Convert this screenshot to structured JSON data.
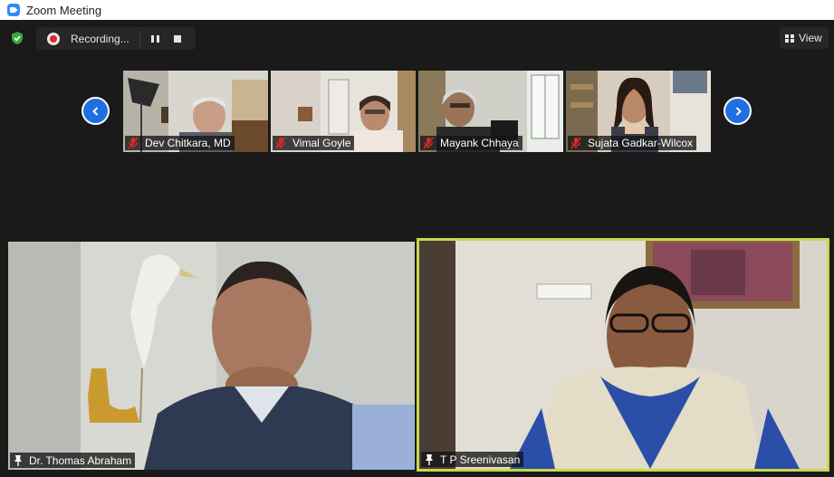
{
  "window": {
    "title": "Zoom Meeting"
  },
  "toolbar": {
    "recording_label": "Recording...",
    "view_label": "View"
  },
  "gallery_strip": [
    {
      "name": "Dev Chitkara, MD",
      "audio_muted": true
    },
    {
      "name": "Vimal Goyle",
      "audio_muted": true
    },
    {
      "name": "Mayank Chhaya",
      "audio_muted": true
    },
    {
      "name": "Sujata Gadkar-Wilcox",
      "audio_muted": true
    }
  ],
  "main_tiles": [
    {
      "name": "Dr. Thomas Abraham",
      "pinned": true,
      "active_speaker": false
    },
    {
      "name": "T P Sreenivasan",
      "pinned": true,
      "active_speaker": true
    }
  ],
  "colors": {
    "accent_blue": "#1f6fe0",
    "active_speaker_border": "#c6d84d",
    "recording_red": "#e02828",
    "security_green": "#3aa935"
  },
  "icons": [
    "zoom-logo-icon",
    "shield-check-icon",
    "record-dot-icon",
    "pause-icon",
    "stop-icon",
    "grid-view-icon",
    "chevron-left-icon",
    "chevron-right-icon",
    "mic-muted-icon",
    "pin-icon"
  ]
}
